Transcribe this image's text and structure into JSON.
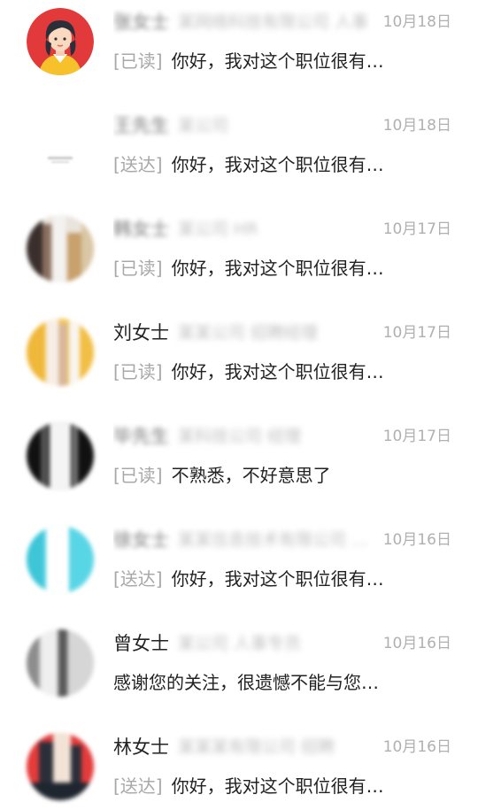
{
  "conversations": [
    {
      "name": "张女士",
      "company": "某网络科技有限公司 人事",
      "date": "10月18日",
      "status": "[已读]",
      "message": "你好，我对这个职位很有…",
      "avatar": "cartoon-woman",
      "name_blurred": true
    },
    {
      "name": "王先生",
      "company": "某公司",
      "date": "10月18日",
      "status": "[送达]",
      "message": "你好，我对这个职位很有…",
      "avatar": "logo",
      "name_blurred": true
    },
    {
      "name": "韩女士",
      "company": "某公司 HR",
      "date": "10月17日",
      "status": "[已读]",
      "message": "你好，我对这个职位很有…",
      "avatar": "photo-dark",
      "name_blurred": true
    },
    {
      "name": "刘女士",
      "company": "某某公司 招聘经理",
      "date": "10月17日",
      "status": "[已读]",
      "message": "你好，我对这个职位很有…",
      "avatar": "photo-yellow",
      "name_blurred": false
    },
    {
      "name": "毕先生",
      "company": "某科技公司 经理",
      "date": "10月17日",
      "status": "[已读]",
      "message": "不熟悉，不好意思了",
      "avatar": "photo-black",
      "name_blurred": true
    },
    {
      "name": "徐女士",
      "company": "某某信息技术有限公司 …",
      "date": "10月16日",
      "status": "[送达]",
      "message": "你好，我对这个职位很有…",
      "avatar": "photo-cyan",
      "name_blurred": true
    },
    {
      "name": "曾女士",
      "company": "某公司 人事专员",
      "date": "10月16日",
      "status": "",
      "message": "感谢您的关注，很遗憾不能与您…",
      "avatar": "photo-grey",
      "name_blurred": false
    },
    {
      "name": "林女士",
      "company": "某某某有限公司 招聘",
      "date": "10月16日",
      "status": "[送达]",
      "message": "你好，我对这个职位很有…",
      "avatar": "photo-red",
      "name_blurred": false
    }
  ],
  "colors": {
    "accent_red": "#e53935",
    "text_primary": "#222222",
    "text_muted": "#a8a8a8",
    "background": "#ffffff"
  }
}
